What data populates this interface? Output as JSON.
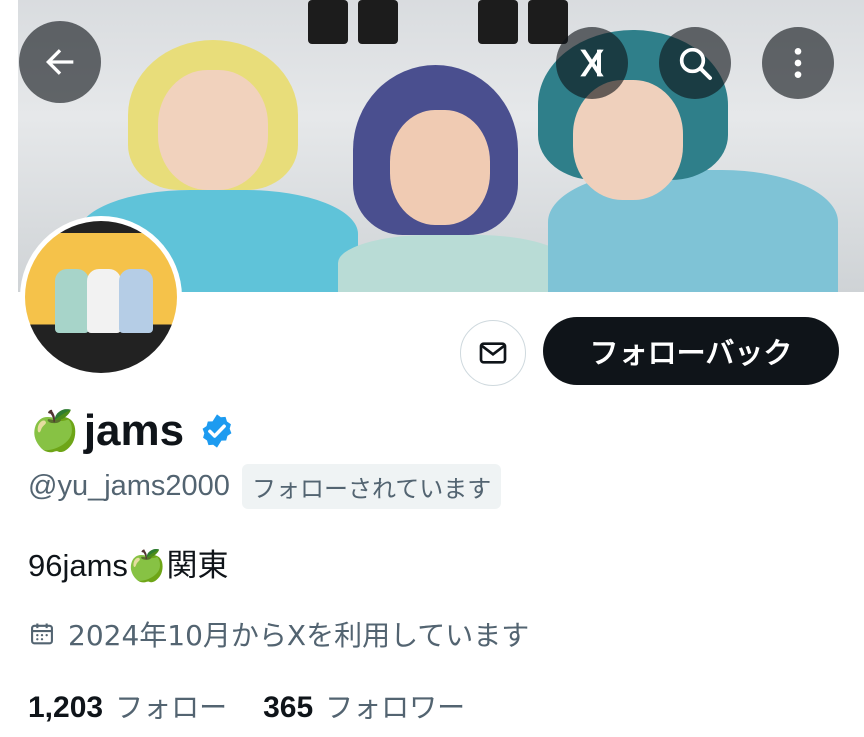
{
  "header": {
    "back_icon": "arrow-left-icon",
    "grok_icon": "grok-icon",
    "search_icon": "search-icon",
    "more_icon": "more-vertical-icon"
  },
  "profile": {
    "display_name_emoji": "🍏",
    "display_name": "jams",
    "verified": true,
    "verified_color": "#1d9bf0",
    "handle": "@yu_jams2000",
    "follows_you_label": "フォローされています",
    "bio": "96jams🍏関東",
    "joined": "2024年10月からXを利用しています",
    "following_count": "1,203",
    "following_label": "フォロー",
    "followers_count": "365",
    "followers_label": "フォロワー"
  },
  "actions": {
    "message_icon": "envelope-icon",
    "follow_back_label": "フォローバック"
  },
  "colors": {
    "primary_text": "#0f1419",
    "secondary_text": "#536471",
    "button_dark": "#0f1419",
    "avatar_bg": "#f5c24a"
  }
}
